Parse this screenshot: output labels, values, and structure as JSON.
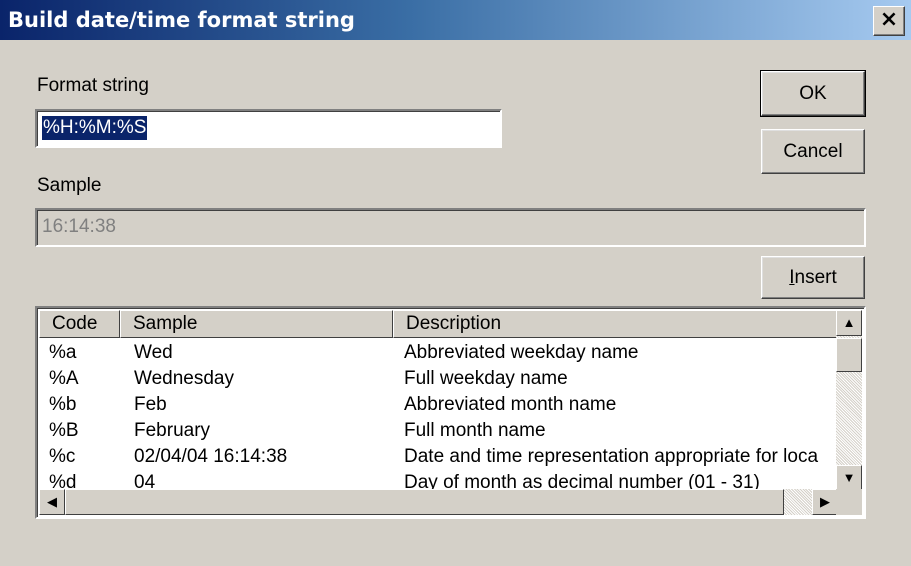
{
  "window": {
    "title": "Build date/time format string",
    "close_glyph": "×"
  },
  "format": {
    "label": "Format string",
    "value": "%H:%M:%S"
  },
  "sample": {
    "label": "Sample",
    "value": "16:14:38"
  },
  "buttons": {
    "ok": "OK",
    "cancel": "Cancel",
    "insert_prefix": "I",
    "insert_rest": "nsert"
  },
  "list": {
    "headers": [
      "Code",
      "Sample",
      "Description"
    ],
    "rows": [
      [
        "%a",
        "Wed",
        "Abbreviated weekday name"
      ],
      [
        "%A",
        "Wednesday",
        "Full weekday name"
      ],
      [
        "%b",
        "Feb",
        "Abbreviated month name"
      ],
      [
        "%B",
        "February",
        "Full month name"
      ],
      [
        "%c",
        "02/04/04 16:14:38",
        "Date and time representation appropriate for loca"
      ],
      [
        "%d",
        "04",
        "Day of month as decimal number (01 - 31)"
      ]
    ]
  },
  "scroll": {
    "up": "▲",
    "down": "▼",
    "left": "◀",
    "right": "▶"
  }
}
